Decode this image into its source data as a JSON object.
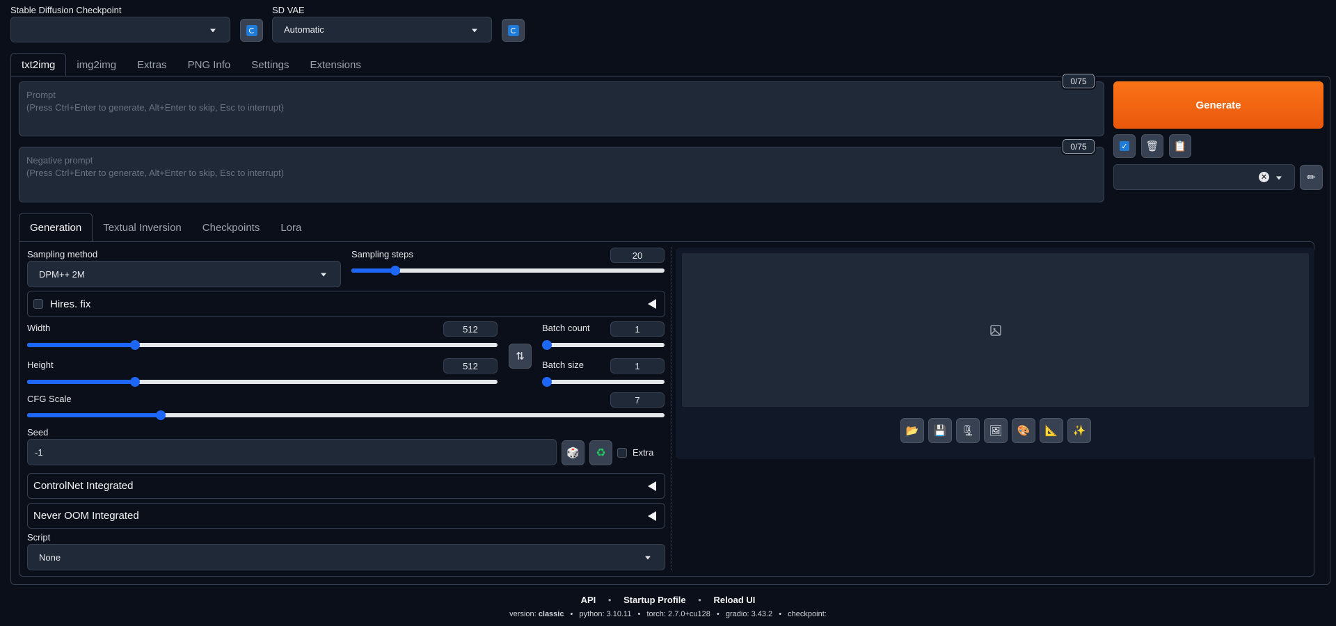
{
  "top": {
    "checkpoint_label": "Stable Diffusion Checkpoint",
    "checkpoint_value": "",
    "vae_label": "SD VAE",
    "vae_value": "Automatic"
  },
  "main_tabs": [
    "txt2img",
    "img2img",
    "Extras",
    "PNG Info",
    "Settings",
    "Extensions"
  ],
  "prompt": {
    "placeholder_title": "Prompt",
    "placeholder_hint": "(Press Ctrl+Enter to generate, Alt+Enter to skip, Esc to interrupt)",
    "counter": "0/75"
  },
  "negative_prompt": {
    "placeholder_title": "Negative prompt",
    "placeholder_hint": "(Press Ctrl+Enter to generate, Alt+Enter to skip, Esc to interrupt)",
    "counter": "0/75"
  },
  "generate_label": "Generate",
  "sub_tabs": [
    "Generation",
    "Textual Inversion",
    "Checkpoints",
    "Lora"
  ],
  "generation": {
    "sampling_method_label": "Sampling method",
    "sampling_method_value": "DPM++ 2M",
    "sampling_steps_label": "Sampling steps",
    "sampling_steps_value": "20",
    "sampling_steps_fraction": 0.14,
    "hires_fix_label": "Hires. fix",
    "width_label": "Width",
    "width_value": "512",
    "width_fraction": 0.23,
    "height_label": "Height",
    "height_value": "512",
    "height_fraction": 0.23,
    "batch_count_label": "Batch count",
    "batch_count_value": "1",
    "batch_size_label": "Batch size",
    "batch_size_value": "1",
    "cfg_label": "CFG Scale",
    "cfg_value": "7",
    "cfg_fraction": 0.21,
    "seed_label": "Seed",
    "seed_value": "-1",
    "extra_label": "Extra",
    "controlnet_label": "ControlNet Integrated",
    "neveroom_label": "Never OOM Integrated",
    "script_label": "Script",
    "script_value": "None"
  },
  "footer": {
    "links": [
      "API",
      "Startup Profile",
      "Reload UI"
    ],
    "separator": "•",
    "version_label": "version:",
    "version_value": "classic",
    "python": "python: 3.10.11",
    "torch": "torch: 2.7.0+cu128",
    "gradio": "gradio: 3.43.2",
    "checkpoint": "checkpoint:"
  },
  "icons": {
    "open_folder": "📂",
    "save": "💾",
    "zip": "🗜",
    "image": "🖼",
    "palette": "🎨",
    "ruler": "📐",
    "sparkle": "✨",
    "dice": "🎲",
    "recycle": "♻",
    "trash": "🗑",
    "clipboard": "📋",
    "pencil": "✏"
  },
  "colors": {
    "accent": "#1e66f5",
    "generate": "#ea580c"
  }
}
